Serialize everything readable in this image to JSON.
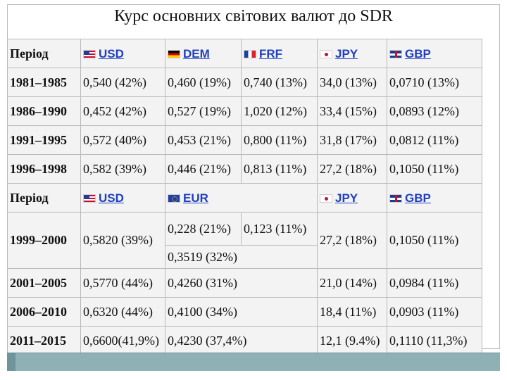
{
  "title": "Курс основних світових валют до SDR",
  "header1": {
    "period": "Період",
    "currencies": [
      {
        "code": "USD",
        "flag": "us-flag-icon"
      },
      {
        "code": "DEM",
        "flag": "de-flag-icon"
      },
      {
        "code": "FRF",
        "flag": "fr-flag-icon"
      },
      {
        "code": "JPY",
        "flag": "jp-flag-icon"
      },
      {
        "code": "GBP",
        "flag": "gb-flag-icon"
      }
    ]
  },
  "rows1": [
    {
      "period": "1981–1985",
      "usd": "0,540 (42%)",
      "dem": "0,460 (19%)",
      "frf": "0,740 (13%)",
      "jpy": "34,0 (13%)",
      "gbp": "0,0710 (13%)"
    },
    {
      "period": "1986–1990",
      "usd": "0,452 (42%)",
      "dem": "0,527 (19%)",
      "frf": "1,020 (12%)",
      "jpy": "33,4 (15%)",
      "gbp": "0,0893 (12%)"
    },
    {
      "period": "1991–1995",
      "usd": "0,572 (40%)",
      "dem": "0,453 (21%)",
      "frf": "0,800 (11%)",
      "jpy": "31,8 (17%)",
      "gbp": "0,0812 (11%)"
    },
    {
      "period": "1996–1998",
      "usd": "0,582 (39%)",
      "dem": "0,446 (21%)",
      "frf": "0,813 (11%)",
      "jpy": "27,2 (18%)",
      "gbp": "0,1050 (11%)"
    }
  ],
  "header2": {
    "period": "Період",
    "usd": "USD",
    "eur": "EUR",
    "jpy": "JPY",
    "gbp": "GBP"
  },
  "row1999": {
    "period": "1999–2000",
    "usd": "0,5820 (39%)",
    "eur_dem": "0,228 (21%)",
    "eur_frf": "0,123 (11%)",
    "eur_total": "0,3519 (32%)",
    "jpy": "27,2 (18%)",
    "gbp": "0,1050 (11%)"
  },
  "rows2": [
    {
      "period": "2001–2005",
      "usd": "0,5770 (44%)",
      "eur": "0,4260 (31%)",
      "jpy": "21,0 (14%)",
      "gbp": "0,0984 (11%)"
    },
    {
      "period": "2006–2010",
      "usd": "0,6320 (44%)",
      "eur": "0,4100 (34%)",
      "jpy": "18,4 (11%)",
      "gbp": "0,0903 (11%)"
    },
    {
      "period": "2011–2015",
      "usd": "0,6600(41,9%)",
      "eur": "0,4230 (37,4%)",
      "jpy": "12,1 (9.4%)",
      "gbp": "0,1110 (11,3%)"
    }
  ]
}
